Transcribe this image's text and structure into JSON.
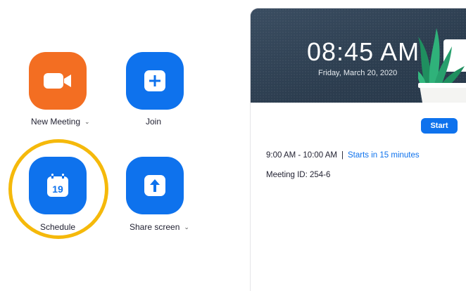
{
  "actions": {
    "new_meeting": {
      "label": "New Meeting",
      "chevron": "⌄"
    },
    "join": {
      "label": "Join"
    },
    "schedule": {
      "label": "Schedule",
      "calendar_day": "19"
    },
    "share_screen": {
      "label": "Share screen",
      "chevron": "⌄"
    }
  },
  "clock": {
    "time": "08:45 AM",
    "date": "Friday, March 20, 2020"
  },
  "meeting": {
    "start_label": "Start",
    "time_range": "9:00 AM - 10:00 AM",
    "separator": "|",
    "starts_in": "Starts in 15 minutes",
    "meeting_id": "Meeting ID: 254-6"
  },
  "colors": {
    "orange": "#f36e22",
    "blue": "#0e72ed",
    "highlight": "#f5b90b",
    "header_bg": "#2f4154"
  },
  "icons": {
    "new_meeting": "video-camera-icon",
    "join": "plus-icon",
    "schedule": "calendar-icon",
    "share_screen": "arrow-up-icon"
  }
}
